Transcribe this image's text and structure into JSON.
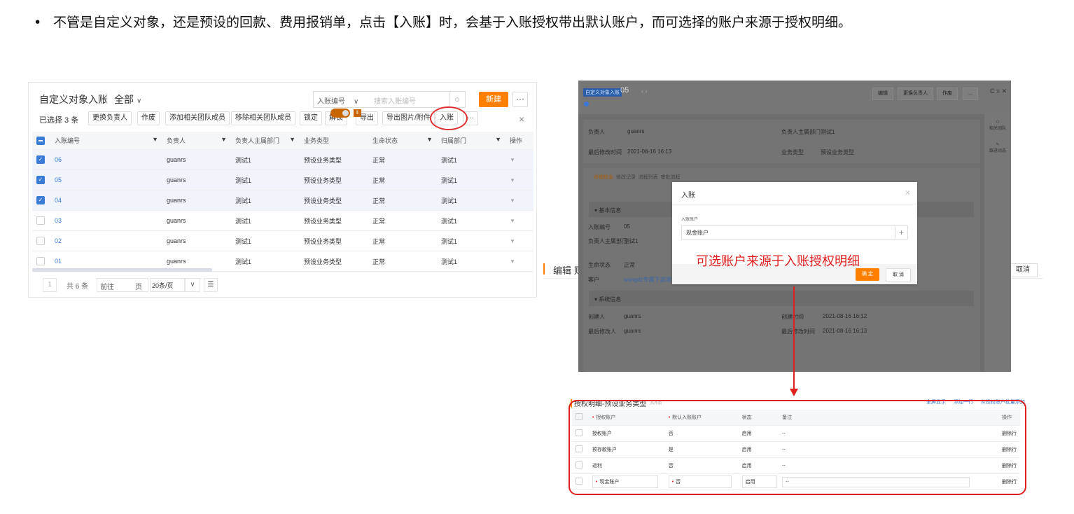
{
  "bullet": {
    "dot": "•",
    "text": "不管是自定义对象，还是预设的回款、费用报销单，点击【入账】时，会基于入账授权带出默认账户，而可选择的账户来源于授权明细。"
  },
  "list": {
    "title": "自定义对象入账",
    "filter": "全部",
    "search_field": "入账编号",
    "search_placeholder": "搜索入账编号",
    "new_button": "新建",
    "more_button": "···",
    "selected_text": "已选择 3 条",
    "toolbar_buttons": [
      "更换负责人",
      "作废",
      "添加相关团队成员",
      "移除相关团队成员",
      "锁定",
      "解锁",
      "导出",
      "导出图片/附件",
      "入账",
      "···"
    ],
    "close": "×",
    "columns": [
      "入账编号",
      "负责人",
      "负责人主属部门",
      "业务类型",
      "生命状态",
      "归属部门",
      "操作"
    ],
    "rows": [
      {
        "id": "06",
        "owner": "guanrs",
        "dept": "测试1",
        "type": "预设业务类型",
        "status": "正常",
        "belong": "测试1",
        "checked": true
      },
      {
        "id": "05",
        "owner": "guanrs",
        "dept": "测试1",
        "type": "预设业务类型",
        "status": "正常",
        "belong": "测试1",
        "checked": true
      },
      {
        "id": "04",
        "owner": "guanrs",
        "dept": "测试1",
        "type": "预设业务类型",
        "status": "正常",
        "belong": "测试1",
        "checked": true
      },
      {
        "id": "03",
        "owner": "guanrs",
        "dept": "测试1",
        "type": "预设业务类型",
        "status": "正常",
        "belong": "测试1",
        "checked": false
      },
      {
        "id": "02",
        "owner": "guanrs",
        "dept": "测试1",
        "type": "预设业务类型",
        "status": "正常",
        "belong": "测试1",
        "checked": false
      },
      {
        "id": "01",
        "owner": "guanrs",
        "dept": "测试1",
        "type": "预设业务类型",
        "status": "正常",
        "belong": "测试1",
        "checked": false
      }
    ],
    "pager": {
      "page": "1",
      "total": "共 6 条",
      "goto_prefix": "前往",
      "goto_suffix": "页",
      "page_size": "20条/页"
    }
  },
  "edit_strip": {
    "title": "编辑 则",
    "cancel": "取消"
  },
  "detail": {
    "tag": "自定义对象入账",
    "number": "05",
    "nav": "‹ ›",
    "buttons": [
      "编辑",
      "更换负责人",
      "作废",
      "..."
    ],
    "window_icons": "C ⌗ ✕",
    "owner_label": "负责人",
    "owner_value": "guanrs",
    "owner_dept_label": "负责人主属部门",
    "owner_dept_value": "测试1",
    "modified_label": "最后修改时间",
    "modified_value": "2021-08-16 16:13",
    "biz_type_label": "业务类型",
    "biz_type_value": "预设业务类型",
    "tabs": [
      "详细信息",
      "修改记录",
      "流程列表",
      "审批流程"
    ],
    "section_basic": "▾ 基本信息",
    "id_label": "入账编号",
    "id_value": "05",
    "dept_label": "负责人主属部门",
    "dept_value": "测试1",
    "life_label": "生命状态",
    "life_value": "正常",
    "customer_label": "客户",
    "customer_value": "wangdz专属下游测试",
    "section_system": "▾ 系统信息",
    "creator_label": "创建人",
    "creator_value": "guanrs",
    "created_label": "创建时间",
    "created_value": "2021-08-16 16:12",
    "last_mod_label": "最后修改人",
    "last_mod_value": "guanrs",
    "last_mod_time_label": "最后修改时间",
    "last_mod_time_value": "2021-08-16 16:13",
    "side_items": [
      "相关团队",
      "跟进动态"
    ]
  },
  "modal": {
    "title": "入账",
    "close": "×",
    "field_label": "入账账户",
    "field_value": "现金账户",
    "plus": "+",
    "note": "可选账户来源于入账授权明细",
    "ok": "确 定",
    "cancel": "取 消"
  },
  "auth": {
    "title": "授权明细-预设业务类型",
    "count": "共4条",
    "links": [
      "全屏显示",
      "添加一行",
      "从授权账户批量添加"
    ],
    "columns": [
      "授权账户",
      "默认入账账户",
      "状态",
      "备注",
      "操作"
    ],
    "rows": [
      {
        "account": "授权账户",
        "default": "否",
        "status": "启用",
        "note": "--",
        "op": "删除行"
      },
      {
        "account": "预存款账户",
        "default": "是",
        "status": "启用",
        "note": "--",
        "op": "删除行"
      },
      {
        "account": "返利",
        "default": "否",
        "status": "启用",
        "note": "--",
        "op": "删除行"
      },
      {
        "account": "现金账户",
        "default": "否",
        "status": "启用",
        "note": "--",
        "op": "删除行"
      }
    ]
  },
  "colors": {
    "accent": "#ff8000",
    "annotation": "#e02020",
    "link": "#3a7bd5"
  }
}
